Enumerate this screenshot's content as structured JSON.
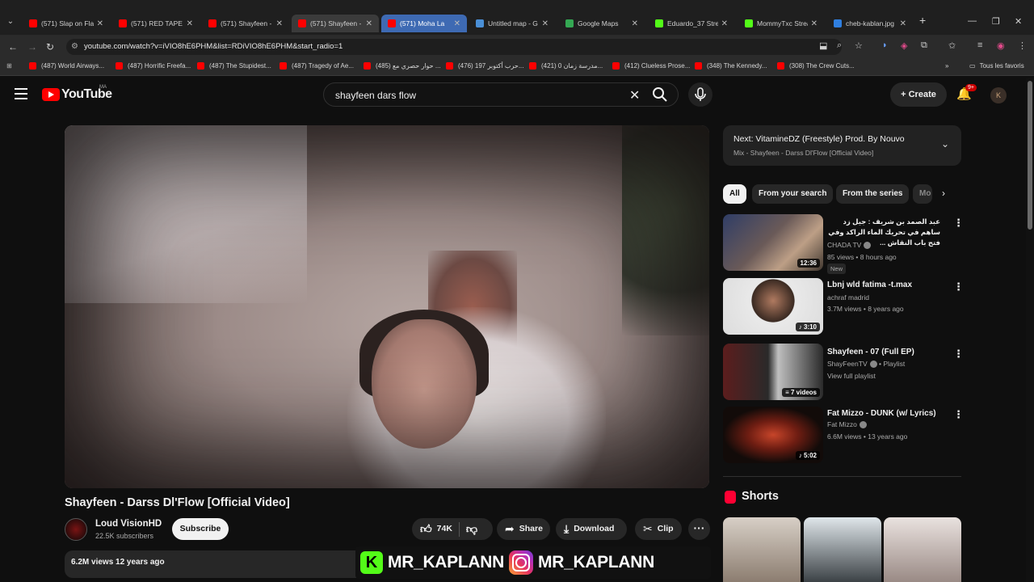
{
  "browser": {
    "tabs": [
      {
        "label": "(571) Slap on Flat",
        "icon": "youtube-icon"
      },
      {
        "label": "(571) RED TAPE",
        "icon": "youtube-icon"
      },
      {
        "label": "(571) Shayfeen -",
        "icon": "youtube-icon"
      },
      {
        "label": "(571) Shayfeen -",
        "icon": "youtube-icon"
      },
      {
        "label": "(571) Moha La",
        "icon": "youtube-icon"
      },
      {
        "label": "Untitled map - G",
        "icon": "earth-icon"
      },
      {
        "label": "Google Maps",
        "icon": "maps-icon"
      },
      {
        "label": "Eduardo_37 Strea",
        "icon": "kick-icon"
      },
      {
        "label": "MommyTxc Strea",
        "icon": "kick-icon"
      },
      {
        "label": "cheb-kablan.jpg",
        "icon": "image-icon"
      }
    ],
    "new_tab": "+",
    "url": "youtube.com/watch?v=iVIO8hE6PHM&list=RDiVIO8hE6PHM&start_radio=1",
    "bookmarks": [
      "(487) World Airways...",
      "(487) Horrific Freefa...",
      "(487) The Stupidest...",
      "(487) Tragedy of Ae...",
      "(485) حوار حصري مع ...",
      "(476) حرب أكتوبر 197...",
      "(421) مدرسة زمان 0...",
      "(412) Clueless Prose...",
      "(348) The Kennedy...",
      "(308) The Crew Cuts..."
    ],
    "bookmarks_more": "»",
    "all_bookmarks": "Tous les favoris"
  },
  "youtube": {
    "logo_text": "YouTube",
    "country": "MA",
    "search_query": "shayfeen dars flow",
    "create_label": "Create",
    "notif_count": "9+",
    "avatar_letter": "K"
  },
  "video": {
    "title": "Shayfeen - Darss Dl'Flow [Official Video]",
    "channel": "Loud VisionHD",
    "subscribers": "22.5K subscribers",
    "subscribe_label": "Subscribe",
    "likes": "74K",
    "share_label": "Share",
    "download_label": "Download",
    "clip_label": "Clip",
    "views_line": "6.2M views  12 years ago"
  },
  "overlay": {
    "kick_letter": "K",
    "kick_handle": "MR_KAPLANN",
    "insta_handle": "MR_KAPLANN"
  },
  "sidebar": {
    "next_title": "Next: VitamineDZ (Freestyle) Prod. By Nouvo",
    "next_sub": "Mix - Shayfeen - Darss Dl'Flow [Official Video]",
    "chips": [
      "All",
      "From your search",
      "From the series",
      "Mo"
    ],
    "recommendations": [
      {
        "title": "عبد الصمد بن شريف : جيل زد ساهم في تحريك الماء الراكد وفي فتح باب النقاش ...",
        "channel": "CHADA TV",
        "meta": "85 views • 8 hours ago",
        "badge": "New",
        "duration": "12:36"
      },
      {
        "title": "Lbnj wld fatima -t.max",
        "channel": "achraf madrid",
        "meta": "3.7M views • 8 years ago",
        "duration": "3:10"
      },
      {
        "title": "Shayfeen - 07 (Full EP)",
        "channel": "ShayFeenTV",
        "channel_suffix": "• Playlist",
        "meta": "View full playlist",
        "duration": "7 videos"
      },
      {
        "title": "Fat Mizzo - DUNK (w/ Lyrics)",
        "channel": "Fat Mizzo",
        "meta": "6.6M views • 13 years ago",
        "duration": "5:02"
      }
    ],
    "shorts_label": "Shorts"
  },
  "colors": {
    "bg": "#0f0f0f",
    "accent": "#ff0000",
    "kick": "#53fc18",
    "active_tab": "#3e6ab3"
  }
}
